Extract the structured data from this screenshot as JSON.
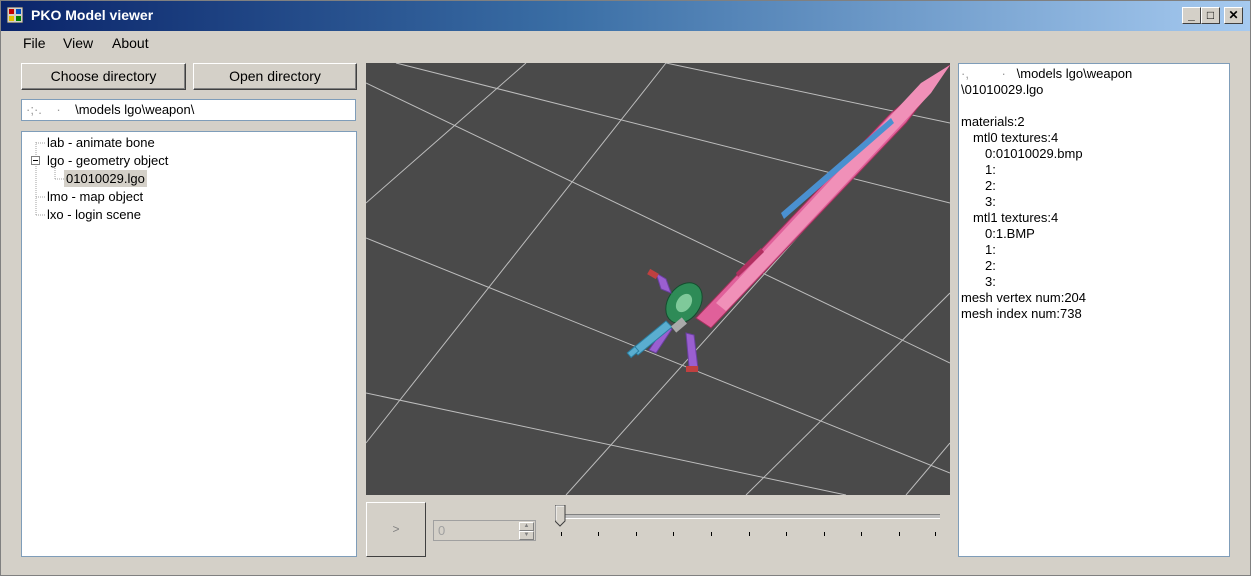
{
  "window": {
    "title": "PKO Model viewer",
    "controls": [
      "_",
      "□",
      "✕"
    ]
  },
  "menu": [
    "File",
    "View",
    "About"
  ],
  "toolbar": {
    "choose_directory": "Choose directory",
    "open_directory": "Open directory"
  },
  "path_input": {
    "value": "\\models lgo\\weapon\\"
  },
  "tree": [
    {
      "label": "lab - animate bone",
      "level": 0,
      "expander": ""
    },
    {
      "label": "lgo - geometry object",
      "level": 0,
      "expander": "⊟"
    },
    {
      "label": "01010029.lgo",
      "level": 1,
      "expander": "",
      "selected": true
    },
    {
      "label": "lmo - map object",
      "level": 0,
      "expander": ""
    },
    {
      "label": "lxo - login scene",
      "level": 0,
      "expander": ""
    }
  ],
  "player": {
    "play_label": ">",
    "frame_value": "0",
    "slider_position": 0
  },
  "info_lines": [
    "\\models lgo\\weapon",
    "\\01010029.lgo",
    "",
    "materials:2",
    "   mtl0 textures:4",
    "      0:01010029.bmp",
    "      1:",
    "      2:",
    "      3:",
    "   mtl1 textures:4",
    "      0:1.BMP",
    "      1:",
    "      2:",
    "      3:",
    "mesh vertex num:204",
    "mesh index num:738"
  ],
  "colors": {
    "titlebar_start": "#0a246a",
    "titlebar_end": "#a6caf0",
    "viewport_bg": "#4a4a4a",
    "grid_line": "#bfbfbf",
    "blade_pink": "#e0609a",
    "blade_blue": "#4a90d0",
    "guard_green": "#2e8b57"
  }
}
